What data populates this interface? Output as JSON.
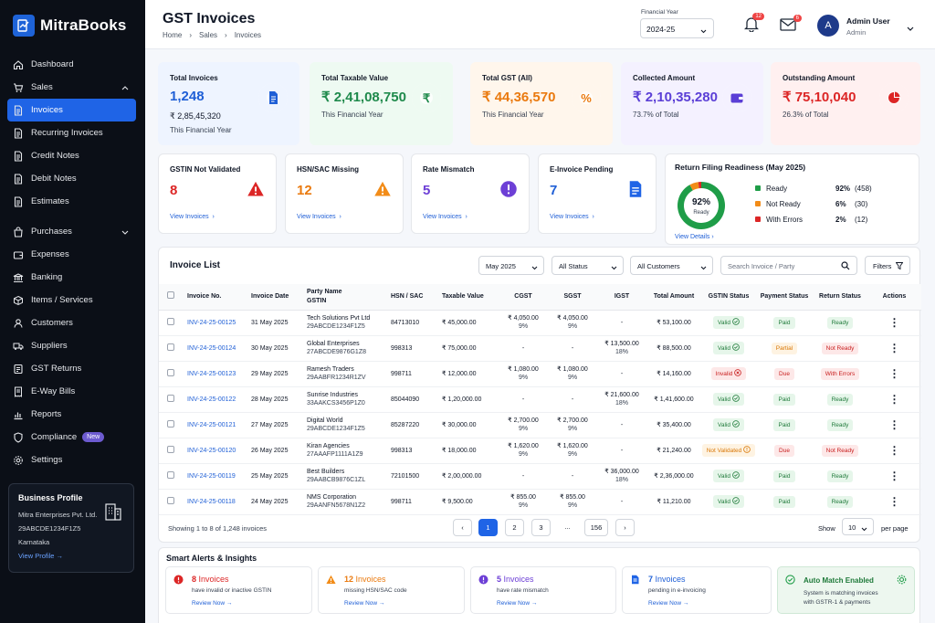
{
  "app": {
    "name": "MitraBooks"
  },
  "sidebar": {
    "items": [
      {
        "label": "Dashboard",
        "icon": "home-icon"
      },
      {
        "label": "Sales",
        "icon": "cart-icon"
      },
      {
        "label": "Invoices",
        "icon": "document-icon"
      },
      {
        "label": "Recurring Invoices",
        "icon": "document-icon"
      },
      {
        "label": "Credit Notes",
        "icon": "document-icon"
      },
      {
        "label": "Debit Notes",
        "icon": "document-icon"
      },
      {
        "label": "Estimates",
        "icon": "document-icon"
      },
      {
        "label": "Purchases",
        "icon": "bag-icon"
      },
      {
        "label": "Expenses",
        "icon": "wallet-icon"
      },
      {
        "label": "Banking",
        "icon": "bank-icon"
      },
      {
        "label": "Items / Services",
        "icon": "box-icon"
      },
      {
        "label": "Customers",
        "icon": "user-icon"
      },
      {
        "label": "Suppliers",
        "icon": "truck-icon"
      },
      {
        "label": "GST Returns",
        "icon": "file-icon"
      },
      {
        "label": "E-Way Bills",
        "icon": "receipt-icon"
      },
      {
        "label": "Reports",
        "icon": "chart-icon"
      },
      {
        "label": "Compliance",
        "icon": "shield-icon",
        "badge": "New"
      },
      {
        "label": "Settings",
        "icon": "gear-icon"
      }
    ],
    "business": {
      "title": "Business Profile",
      "name": "Mitra Enterprises Pvt. Ltd.",
      "gstin": "29ABCDE1234F1Z5",
      "state": "Karnataka",
      "link": "View Profile"
    }
  },
  "header": {
    "title": "GST Invoices",
    "breadcrumb": [
      "Home",
      "Sales",
      "Invoices"
    ],
    "fy_label": "Financial Year",
    "fy_value": "2024-25",
    "notif_count": "12",
    "mail_count": "6",
    "avatar": "A",
    "user_name": "Admin User",
    "user_role": "Admin"
  },
  "kpis": [
    {
      "label": "Total Invoices",
      "value": "1,248",
      "sub1": "₹ 2,85,45,320",
      "sub2": "This Financial Year",
      "color": "#1f5fd6",
      "bg": "#eef4ff",
      "icon": "document-icon"
    },
    {
      "label": "Total Taxable Value",
      "value": "₹ 2,41,08,750",
      "sub": "This Financial Year",
      "color": "#1f8a4c",
      "bg": "#eefaf2",
      "icon": "rupee-icon"
    },
    {
      "label": "Total GST (All)",
      "value": "₹ 44,36,570",
      "sub": "This Financial Year",
      "color": "#ea7a0f",
      "bg": "#fff6ec",
      "icon": "percent-icon"
    },
    {
      "label": "Collected Amount",
      "value": "₹ 2,10,35,280",
      "sub": "73.7% of Total",
      "color": "#5b3fd6",
      "bg": "#f4f1ff",
      "icon": "wallet-icon"
    },
    {
      "label": "Outstanding Amount",
      "value": "₹ 75,10,040",
      "sub": "26.3% of Total",
      "color": "#dc2626",
      "bg": "#fff0f0",
      "icon": "pie-icon"
    }
  ],
  "alerts": [
    {
      "label": "GSTIN Not Validated",
      "value": "8",
      "link": "View Invoices",
      "color": "#dc2626"
    },
    {
      "label": "HSN/SAC Missing",
      "value": "12",
      "link": "View Invoices",
      "color": "#ea7a0f"
    },
    {
      "label": "Rate Mismatch",
      "value": "5",
      "link": "View Invoices",
      "color": "#6d3fd6"
    },
    {
      "label": "E-Invoice Pending",
      "value": "7",
      "link": "View Invoices",
      "color": "#1f5fd6"
    }
  ],
  "readiness": {
    "title": "Return Filing Readiness (May 2025)",
    "center_pct": "92%",
    "center_label": "Ready",
    "link": "View Details",
    "items": [
      {
        "label": "Ready",
        "pct": "92%",
        "count": "(458)",
        "color": "#1f9d48",
        "fraction": 0.92
      },
      {
        "label": "Not Ready",
        "pct": "6%",
        "count": "(30)",
        "color": "#f28c18",
        "fraction": 0.06
      },
      {
        "label": "With Errors",
        "pct": "2%",
        "count": "(12)",
        "color": "#dc2626",
        "fraction": 0.02
      }
    ]
  },
  "invoice_list": {
    "title": "Invoice List",
    "filters": {
      "month": "May 2025",
      "status": "All Status",
      "customers": "All Customers",
      "search_placeholder": "Search Invoice / Party",
      "filters_btn": "Filters"
    },
    "columns": [
      "Invoice No.",
      "Invoice Date",
      "Party Name",
      "GSTIN",
      "HSN / SAC",
      "Taxable Value",
      "CGST",
      "SGST",
      "IGST",
      "Total Amount",
      "GSTIN Status",
      "Payment Status",
      "Return Status",
      "Actions"
    ],
    "rows": [
      {
        "no": "INV-24-25-00125",
        "date": "31 May 2025",
        "party": "Tech Solutions Pvt Ltd",
        "gstin": "29ABCDE1234F1Z5",
        "hsn": "84713010",
        "taxable": "₹ 45,000.00",
        "cgst": "₹ 4,050.00",
        "cgst_r": "9%",
        "sgst": "₹ 4,050.00",
        "sgst_r": "9%",
        "igst": "-",
        "igst_r": "",
        "total": "₹ 53,100.00",
        "gst_status": "Valid",
        "gst_cls": "p-valid",
        "pay": "Paid",
        "pay_cls": "p-paid",
        "ret": "Ready",
        "ret_cls": "p-ready"
      },
      {
        "no": "INV-24-25-00124",
        "date": "30 May 2025",
        "party": "Global Enterprises",
        "gstin": "27ABCDE9876G1Z8",
        "hsn": "998313",
        "taxable": "₹ 75,000.00",
        "cgst": "-",
        "cgst_r": "",
        "sgst": "-",
        "sgst_r": "",
        "igst": "₹ 13,500.00",
        "igst_r": "18%",
        "total": "₹ 88,500.00",
        "gst_status": "Valid",
        "gst_cls": "p-valid",
        "pay": "Partial",
        "pay_cls": "p-partial",
        "ret": "Not Ready",
        "ret_cls": "p-notready"
      },
      {
        "no": "INV-24-25-00123",
        "date": "29 May 2025",
        "party": "Ramesh Traders",
        "gstin": "29AABFR1234R1ZV",
        "hsn": "998711",
        "taxable": "₹ 12,000.00",
        "cgst": "₹ 1,080.00",
        "cgst_r": "9%",
        "sgst": "₹ 1,080.00",
        "sgst_r": "9%",
        "igst": "-",
        "igst_r": "",
        "total": "₹ 14,160.00",
        "gst_status": "Invalid",
        "gst_cls": "p-invalid",
        "pay": "Due",
        "pay_cls": "p-due",
        "ret": "With Errors",
        "ret_cls": "p-errors"
      },
      {
        "no": "INV-24-25-00122",
        "date": "28 May 2025",
        "party": "Sunrise Industries",
        "gstin": "33AAKCS3456P1Z0",
        "hsn": "85044090",
        "taxable": "₹ 1,20,000.00",
        "cgst": "-",
        "cgst_r": "",
        "sgst": "-",
        "sgst_r": "",
        "igst": "₹ 21,600.00",
        "igst_r": "18%",
        "total": "₹ 1,41,600.00",
        "gst_status": "Valid",
        "gst_cls": "p-valid",
        "pay": "Paid",
        "pay_cls": "p-paid",
        "ret": "Ready",
        "ret_cls": "p-ready"
      },
      {
        "no": "INV-24-25-00121",
        "date": "27 May 2025",
        "party": "Digital World",
        "gstin": "29ABCDE1234F1Z5",
        "hsn": "85287220",
        "taxable": "₹ 30,000.00",
        "cgst": "₹ 2,700.00",
        "cgst_r": "9%",
        "sgst": "₹ 2,700.00",
        "sgst_r": "9%",
        "igst": "-",
        "igst_r": "",
        "total": "₹ 35,400.00",
        "gst_status": "Valid",
        "gst_cls": "p-valid",
        "pay": "Paid",
        "pay_cls": "p-paid",
        "ret": "Ready",
        "ret_cls": "p-ready"
      },
      {
        "no": "INV-24-25-00120",
        "date": "26 May 2025",
        "party": "Kiran Agencies",
        "gstin": "27AAAFP1111A1Z9",
        "hsn": "998313",
        "taxable": "₹ 18,000.00",
        "cgst": "₹ 1,620.00",
        "cgst_r": "9%",
        "sgst": "₹ 1,620.00",
        "sgst_r": "9%",
        "igst": "-",
        "igst_r": "",
        "total": "₹ 21,240.00",
        "gst_status": "Not Validated",
        "gst_cls": "p-notval",
        "pay": "Due",
        "pay_cls": "p-due",
        "ret": "Not Ready",
        "ret_cls": "p-notready"
      },
      {
        "no": "INV-24-25-00119",
        "date": "25 May 2025",
        "party": "Best Builders",
        "gstin": "29AABCB9876C1ZL",
        "hsn": "72101500",
        "taxable": "₹ 2,00,000.00",
        "cgst": "-",
        "cgst_r": "",
        "sgst": "-",
        "sgst_r": "",
        "igst": "₹ 36,000.00",
        "igst_r": "18%",
        "total": "₹ 2,36,000.00",
        "gst_status": "Valid",
        "gst_cls": "p-valid",
        "pay": "Paid",
        "pay_cls": "p-paid",
        "ret": "Ready",
        "ret_cls": "p-ready"
      },
      {
        "no": "INV-24-25-00118",
        "date": "24 May 2025",
        "party": "NMS Corporation",
        "gstin": "29AANFN5678N1Z2",
        "hsn": "998711",
        "taxable": "₹ 9,500.00",
        "cgst": "₹ 855.00",
        "cgst_r": "9%",
        "sgst": "₹ 855.00",
        "sgst_r": "9%",
        "igst": "-",
        "igst_r": "",
        "total": "₹ 11,210.00",
        "gst_status": "Valid",
        "gst_cls": "p-valid",
        "pay": "Paid",
        "pay_cls": "p-paid",
        "ret": "Ready",
        "ret_cls": "p-ready"
      }
    ],
    "footer": {
      "showing": "Showing 1 to 8 of 1,248 invoices",
      "pages": [
        "1",
        "2",
        "3",
        "...",
        "156"
      ],
      "show_label": "Show",
      "per_page": "10",
      "per_page_label": "per page"
    }
  },
  "insights": {
    "title": "Smart Alerts & Insights",
    "cards": [
      {
        "count": "8",
        "label": "Invoices",
        "desc": "have invalid or inactive GSTIN",
        "link": "Review Now",
        "color": "#dc2626"
      },
      {
        "count": "12",
        "label": "Invoices",
        "desc": "missing HSN/SAC code",
        "link": "Review Now",
        "color": "#ea7a0f"
      },
      {
        "count": "5",
        "label": "Invoices",
        "desc": "have rate mismatch",
        "link": "Review Now",
        "color": "#6d3fd6"
      },
      {
        "count": "7",
        "label": "Invoices",
        "desc": "pending in e-invoicing",
        "link": "Review Now",
        "color": "#1f5fd6"
      }
    ],
    "auto_match": {
      "title": "Auto Match Enabled",
      "line1": "System is matching invoices",
      "line2": "with GSTR-1 & payments"
    }
  }
}
